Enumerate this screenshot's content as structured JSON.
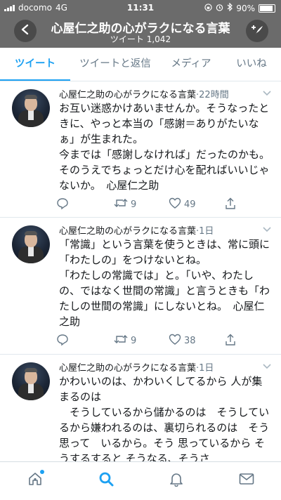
{
  "status_bar": {
    "carrier": "docomo",
    "network": "4G",
    "time": "11:31",
    "battery": "90%"
  },
  "header": {
    "title": "心屋仁之助の心がラクになる言葉",
    "subtitle": "ツイート 1,042"
  },
  "tabs": [
    {
      "label": "ツイート"
    },
    {
      "label": "ツイートと返信"
    },
    {
      "label": "メディア"
    },
    {
      "label": "いいね"
    }
  ],
  "tweets": [
    {
      "name": "心屋仁之助の心がラクになる言葉",
      "dot": "·",
      "time": "22時間",
      "text": "お互い迷惑かけあいませんか。そうなったときに、やっと本当の「感謝＝ありがたいなぁ」が生まれた。\n今までは「感謝しなければ」だったのかも。そのうえでちょっとだけ心を配ればいいじゃないか。　心屋仁之助",
      "retweets": "9",
      "likes": "49"
    },
    {
      "name": "心屋仁之助の心がラクになる言葉",
      "dot": "·",
      "time": "1日",
      "text": "「常識」という言葉を使うときは、常に頭に「わたしの」をつけないとね。\n「わたしの常識では」と。「いや、わたしの、ではなく世間の常識」と言うときも「わたしの世間の常識」にしないとね。　心屋仁之助",
      "retweets": "9",
      "likes": "38"
    },
    {
      "name": "心屋仁之助の心がラクになる言葉",
      "dot": "·",
      "time": "1日",
      "text": "かわいいのは、かわいくしてるから 人が集まるのは\n　そうしているから儲かるのは　そうしているから嫌われるのは、裏切られるのは　そう　思って　いるから。そう 思っているから そうするすると そうなる、そうさ",
      "retweets": "",
      "likes": ""
    }
  ],
  "icons": {
    "back": "chevron-left-icon",
    "compose": "compose-icon",
    "reply": "reply-icon",
    "retweet": "retweet-icon",
    "like": "heart-icon",
    "share": "share-icon",
    "home": "home-icon",
    "search": "search-icon",
    "notifications": "bell-icon",
    "messages": "envelope-icon"
  },
  "colors": {
    "header_bg": "#6b6b6b",
    "accent": "#1da1f2",
    "text": "#14171a",
    "muted": "#657786"
  }
}
